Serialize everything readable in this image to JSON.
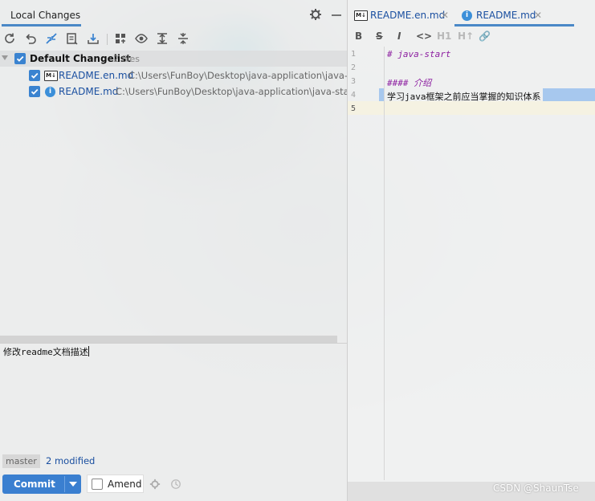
{
  "left_panel": {
    "tab_title": "Local Changes",
    "changelist": {
      "name": "Default Changelist",
      "count": "2 files",
      "files": [
        {
          "name": "README.en.md",
          "path": "C:\\Users\\FunBoy\\Desktop\\java-application\\java-start",
          "icon": "markdown-icon"
        },
        {
          "name": "README.md",
          "path": "C:\\Users\\FunBoy\\Desktop\\java-application\\java-start",
          "icon": "info-icon"
        }
      ]
    },
    "commit_message": "修改readme文档描述",
    "branch": "master",
    "modified_count": "2 modified",
    "commit_button": "Commit",
    "amend_label": "Amend",
    "accent_color": "#3a7fd0"
  },
  "editor": {
    "tabs": [
      {
        "label": "README.en.md",
        "icon": "markdown-icon",
        "active": false
      },
      {
        "label": "README.md",
        "icon": "info-icon",
        "active": true
      }
    ],
    "format_bar": {
      "bold": "B",
      "strike": "S",
      "italic": "I",
      "code": "<>",
      "h1": "H1",
      "h_plus": "H↑",
      "link": "🔗"
    },
    "line_numbers": [
      "1",
      "2",
      "3",
      "4",
      "5"
    ],
    "lines": [
      "# java-start",
      "",
      "#### 介绍",
      "学习java框架之前应当掌握的知识体系",
      ""
    ]
  },
  "watermark": "CSDN @ShaunTse"
}
